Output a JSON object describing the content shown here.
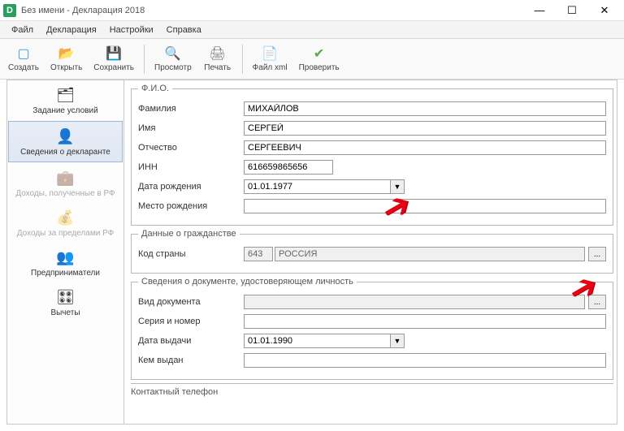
{
  "window": {
    "title": "Без имени - Декларация 2018",
    "app_badge": "D"
  },
  "menu": {
    "file": "Файл",
    "declaration": "Декларация",
    "settings": "Настройки",
    "help": "Справка"
  },
  "toolbar": {
    "create": "Создать",
    "open": "Открыть",
    "save": "Сохранить",
    "preview": "Просмотр",
    "print": "Печать",
    "file_xml": "Файл xml",
    "check": "Проверить"
  },
  "sidebar": {
    "conditions": "Задание условий",
    "declarant": "Сведения о декларанте",
    "income_rf": "Доходы, полученные в РФ",
    "income_foreign": "Доходы за пределами РФ",
    "entrepreneurs": "Предприниматели",
    "deductions": "Вычеты"
  },
  "sections": {
    "fio": {
      "legend": "Ф.И.О.",
      "surname_label": "Фамилия",
      "surname_value": "МИХАЙЛОВ",
      "name_label": "Имя",
      "name_value": "СЕРГЕЙ",
      "patronymic_label": "Отчество",
      "patronymic_value": "СЕРГЕЕВИЧ",
      "inn_label": "ИНН",
      "inn_value": "616659865656",
      "dob_label": "Дата рождения",
      "dob_value": "01.01.1977",
      "pob_label": "Место рождения",
      "pob_value": ""
    },
    "citizenship": {
      "legend": "Данные о гражданстве",
      "country_code_label": "Код страны",
      "country_code": "643",
      "country_name": "РОССИЯ"
    },
    "identity": {
      "legend": "Сведения о документе, удостоверяющем личность",
      "doc_type_label": "Вид документа",
      "doc_type_value": "",
      "series_label": "Серия и номер",
      "series_value": "",
      "issue_date_label": "Дата выдачи",
      "issue_date_value": "01.01.1990",
      "issued_by_label": "Кем выдан",
      "issued_by_value": ""
    },
    "contact": {
      "label": "Контактный телефон"
    }
  },
  "glyph": {
    "minimize": "—",
    "maximize": "☐",
    "close": "✕",
    "dropdown": "▼",
    "dots": "..."
  }
}
